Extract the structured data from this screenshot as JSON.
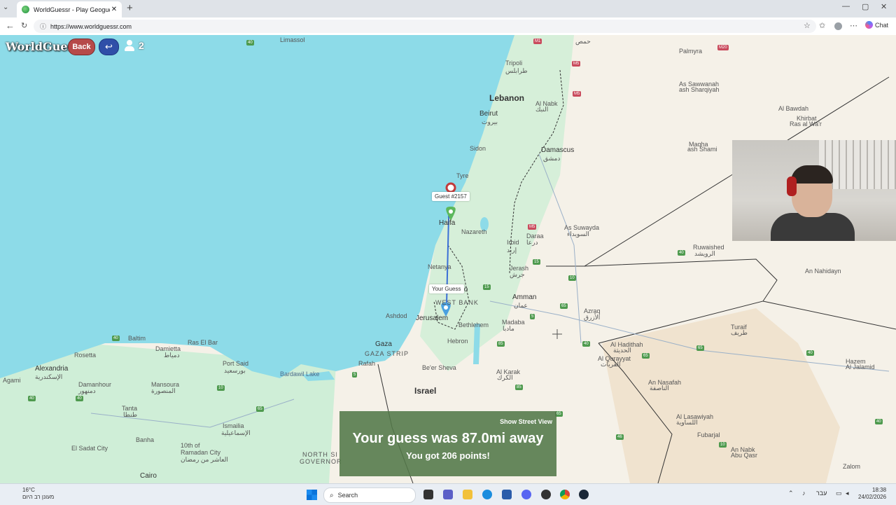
{
  "browser": {
    "tab_title": "WorldGuessr - Play Geoguessr for Free",
    "url": "https://www.worldguessr.com",
    "chat_label": "Chat"
  },
  "game": {
    "brand": "WorldGuessr",
    "back_label": "Back",
    "undo_icon": "undo-arrow-icon",
    "player_count": "2",
    "guest_label": "Guest #2157",
    "your_guess_label": "Your Guess",
    "show_street_view": "Show Street View",
    "distance_text": "Your guess was 87.0mi away",
    "points_text": "You got 206 points!"
  },
  "map_labels": {
    "lebanon": "Lebanon",
    "beirut": "Beirut",
    "beirut_ar": "بيروت",
    "damascus": "Damascus",
    "damascus_ar": "دمشق",
    "tripoli": "Tripoli",
    "tripoli_ar": "طرابلس",
    "homs_ar": "حمص",
    "palmyra": "Palmyra",
    "as_sawwanah": "As Sawwanah",
    "as_sharqiyah": "ash Sharqiyah",
    "al_bawdah": "Al Bawdah",
    "khirbat": "Khirbat",
    "khirbat2": "Ras al Wa'r",
    "maqha": "Maqha",
    "maqha2": "ash Shami",
    "limassol": "Limassol",
    "al_nabk": "Al Nabk",
    "al_nabk_ar": "النبك",
    "sidon": "Sidon",
    "tyre": "Tyre",
    "haifa": "Haifa",
    "nazareth": "Nazareth",
    "irbid": "Irbid",
    "irbid_ar": "إربد",
    "daraa": "Daraa",
    "daraa_ar": "درعا",
    "as_suwayda": "As Suwayda",
    "as_suwayda_ar": "السويداء",
    "ruwaished": "Ruwaished",
    "ruwaished_ar": "الرويشد",
    "an_nahidayn": "An Nahidayn",
    "netanya": "Netanya",
    "jerash": "Jerash",
    "jerash_ar": "جرش",
    "tel_aviv_suffix": "fo",
    "amman": "Amman",
    "amman_ar": "عمان",
    "west_bank": "WEST BANK",
    "jerusalem": "Jerusalem",
    "ashdod": "Ashdod",
    "bethlehem": "Bethlehem",
    "madaba": "Madaba",
    "madaba_ar": "مادبا",
    "azraq": "Azraq",
    "azraq_ar": "الأزرق",
    "hebron": "Hebron",
    "gaza": "Gaza",
    "gaza_strip": "GAZA STRIP",
    "rafah": "Rafah",
    "beer_sheva": "Be'er Sheva",
    "israel": "Israel",
    "al_karak": "Al Karak",
    "al_karak_ar": "الكرك",
    "al_hadithah": "Al Hadithah",
    "al_hadithah_ar": "الحديثة",
    "al_qurayyat": "Al Qurayyat",
    "al_qurayyat_ar": "القريات",
    "an_nasafah": "An Nasafah",
    "an_nasafah_ar": "الناصفة",
    "turaif": "Turaif",
    "turaif_ar": "طريف",
    "hazem": "Hazem",
    "hazem2": "Al Jalamid",
    "al_lasawiyah": "Al Lasawiyah",
    "al_lasawiyah_ar": "اللساوية",
    "fubarjal": "Fubarjal",
    "an_nabk_abu_qasr": "An Nabk",
    "an_nabk2": "Abu Qasr",
    "zalom": "Zalom",
    "alexandria": "Alexandria",
    "alexandria_ar": "الإسكندرية",
    "damietta": "Damietta",
    "damietta_ar": "دمياط",
    "port_said": "Port Said",
    "port_said_ar": "بورسعيد",
    "baltim": "Baltim",
    "rosetta": "Rosetta",
    "ras_el_bar": "Ras El Bar",
    "damanhour": "Damanhour",
    "damanhour_ar": "دمنهور",
    "mansoura": "Mansoura",
    "mansoura_ar": "المنصورة",
    "tanta": "Tanta",
    "tanta_ar": "طنطا",
    "ismailia": "Ismailia",
    "ismailia_ar": "الإسماعيلية",
    "tenth_ramadan": "10th of",
    "tenth_ramadan2": "Ramadan City",
    "tenth_ramadan_ar": "العاشر من رمضان",
    "el_sadat": "El Sadat City",
    "banha": "Banha",
    "cairo": "Cairo",
    "bardawil": "Bardawil Lake",
    "north_sinai": "NORTH SI",
    "north_sinai2": "GOVERNOR",
    "agami": "Agami"
  },
  "road_shields": [
    "M20",
    "M5",
    "M5",
    "M1",
    "M5",
    "15",
    "10",
    "40",
    "15",
    "65",
    "5",
    "40",
    "85",
    "85",
    "65",
    "65",
    "65",
    "40",
    "40",
    "10",
    "10",
    "65",
    "5",
    "40",
    "40",
    "40",
    "40",
    "46"
  ],
  "taskbar": {
    "weather_temp": "16°C",
    "weather_desc": "מעונן רב היום",
    "search_label": "Search",
    "lang": "עבר",
    "time": "18:38",
    "date": "24/02/2026"
  },
  "colors": {
    "sea": "#8ddbe8",
    "land": "#f5f1e8",
    "green_land": "#c8ecd3",
    "desert": "#f0e3cf",
    "guess_line": "#3b6fd6",
    "result_bg": "#527848"
  }
}
